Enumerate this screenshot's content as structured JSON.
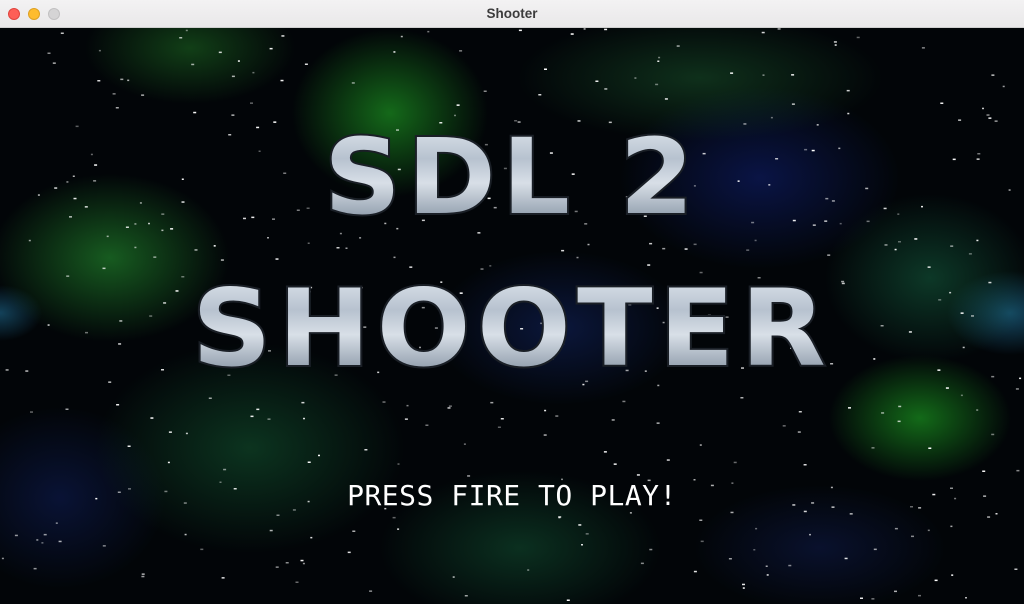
{
  "window": {
    "title": "Shooter"
  },
  "game": {
    "logo_line1": "SDL 2",
    "logo_line2": "SHOOTER",
    "prompt": "PRESS FIRE TO PLAY!"
  },
  "colors": {
    "background": "#020508",
    "nebula_green": "#1e8228",
    "nebula_blue": "#14286e",
    "logo_metal": "#c8d2de",
    "logo_outline": "#1a1f26",
    "prompt_text": "#ffffff",
    "star": "#ffffff"
  },
  "icons": {
    "close": "close-traffic-light",
    "minimize": "minimize-traffic-light",
    "zoom": "zoom-traffic-light"
  }
}
